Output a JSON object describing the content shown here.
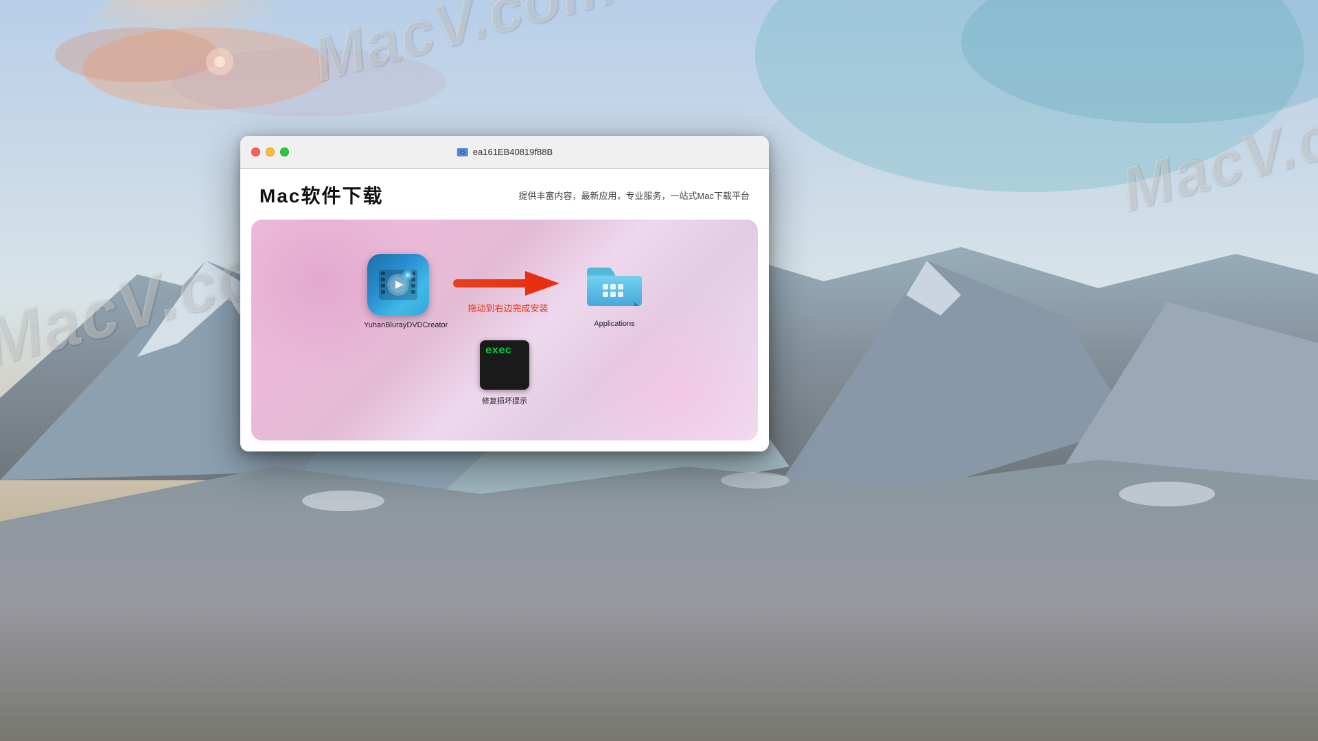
{
  "desktop": {
    "watermarks": [
      "MacV.com",
      "MacV.com",
      "MacV.co"
    ]
  },
  "window": {
    "title": "ea161EB40819f88B",
    "brand": "Mac软件下载",
    "subtitle": "提供丰富内容，最新应用，专业服务，一站式Mac下载平台"
  },
  "dmg": {
    "app_name": "YuhanBlurayDVDCreator",
    "arrow_text": "拖动到右边完成安装",
    "folder_name": "Applications",
    "exec_label": "修复损坏提示",
    "exec_text": "exec"
  },
  "traffic_lights": {
    "close": "close",
    "minimize": "minimize",
    "maximize": "maximize"
  }
}
